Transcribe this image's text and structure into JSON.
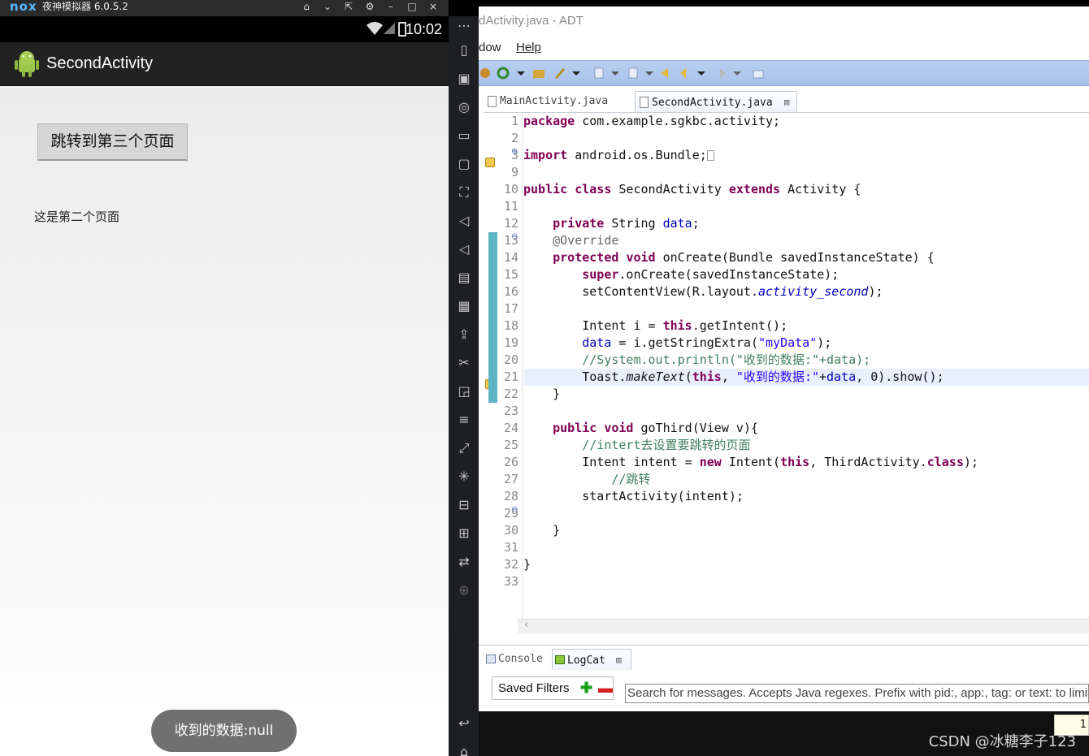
{
  "emulator": {
    "logo": "nox",
    "window_title": "夜神模拟器 6.0.5.2",
    "controls": [
      "⌂",
      "⌄",
      "⇱",
      "⚙",
      "–",
      "□",
      "×"
    ],
    "status_time": "10:02",
    "app_title": "SecondActivity",
    "button_label": "跳转到第三个页面",
    "page_text": "这是第二个页面",
    "toast": "收到的数据:null"
  },
  "sidebar": {
    "icons": [
      "more-icon",
      "shake-icon",
      "robot-icon",
      "location-icon",
      "keyboard-icon",
      "screenshot-icon",
      "fullscreen-icon",
      "volume-up-icon",
      "volume-down-icon",
      "multi-window-icon",
      "macro-icon",
      "apk-install-icon",
      "cut-icon",
      "multi-instance-icon",
      "menu-icon",
      "expand-icon",
      "loading-icon",
      "record-icon",
      "gamepad-icon",
      "sync-icon",
      "add-icon",
      "back-icon",
      "home-icon"
    ]
  },
  "adt": {
    "title": "dActivity.java - ADT",
    "menu": [
      "dow",
      "Help"
    ],
    "tabs": [
      {
        "label": "MainActivity.java",
        "active": false
      },
      {
        "label": "SecondActivity.java",
        "active": true,
        "close": "⊠"
      }
    ],
    "line_numbers": [
      "1",
      "2",
      "3",
      "9",
      "10",
      "11",
      "12",
      "13",
      "14",
      "15",
      "16",
      "17",
      "18",
      "19",
      "20",
      "21",
      "22",
      "23",
      "24",
      "25",
      "26",
      "27",
      "28",
      "29",
      "30",
      "31",
      "32",
      "33"
    ],
    "code": {
      "l1_kw": "package",
      "l1_rest": " com.example.sgkbc.activity;",
      "l3_kw": "import",
      "l3_rest": " android.os.Bundle;",
      "l10_kw1": "public",
      "l10_kw2": "class",
      "l10_mid": " SecondActivity ",
      "l10_kw3": "extends",
      "l10_rest": " Activity {",
      "l12_kw": "private",
      "l12_mid": " String ",
      "l12_fld": "data",
      "l12_end": ";",
      "l13_ann": "@Override",
      "l14_kw1": "protected",
      "l14_kw2": "void",
      "l14_rest": " onCreate(Bundle savedInstanceState) {",
      "l15_kw": "super",
      "l15_rest": ".onCreate(savedInstanceState);",
      "l16_pre": "setContentView(R.layout.",
      "l16_fld": "activity_second",
      "l16_end": ");",
      "l18_pre": "Intent i = ",
      "l18_kw": "this",
      "l18_rest": ".getIntent();",
      "l19_fld": "data",
      "l19_mid": " = i.getStringExtra(",
      "l19_str": "\"myData\"",
      "l19_end": ");",
      "l20_cmt": "//System.out.println(\"收到的数据:\"+data);",
      "l21_pre": "Toast.",
      "l21_it": "makeText",
      "l21_p": "(",
      "l21_kw": "this",
      "l21_c": ", ",
      "l21_str": "\"收到的数据:\"",
      "l21_plus": "+",
      "l21_fld": "data",
      "l21_end": ", 0).show();",
      "l22": "}",
      "l24_kw1": "public",
      "l24_kw2": "void",
      "l24_rest": " goThird(View v){",
      "l25_cmt": "//intert去设置要跳转的页面",
      "l26_pre": "Intent intent = ",
      "l26_kw": "new",
      "l26_mid": " Intent(",
      "l26_kw2": "this",
      "l26_mid2": ", ThirdActivity.",
      "l26_kw3": "class",
      "l26_end": ");",
      "l27_cmt": "//跳转",
      "l28": "startActivity(intent);",
      "l30": "}",
      "l32": "}"
    },
    "bottom_tabs": [
      "Console",
      "LogCat"
    ],
    "saved_filters": "Saved Filters",
    "search_placeholder": "Search for messages. Accepts Java regexes. Prefix with pid:, app:, tag: or text: to limit scope.",
    "level_value": "1"
  },
  "watermark": "CSDN @冰糖李子123",
  "colors": {
    "keyword": "#7f0055",
    "field": "#0000c0",
    "string": "#2a00ff",
    "comment": "#3f7f5f",
    "toolbar": "#b9cff1"
  }
}
